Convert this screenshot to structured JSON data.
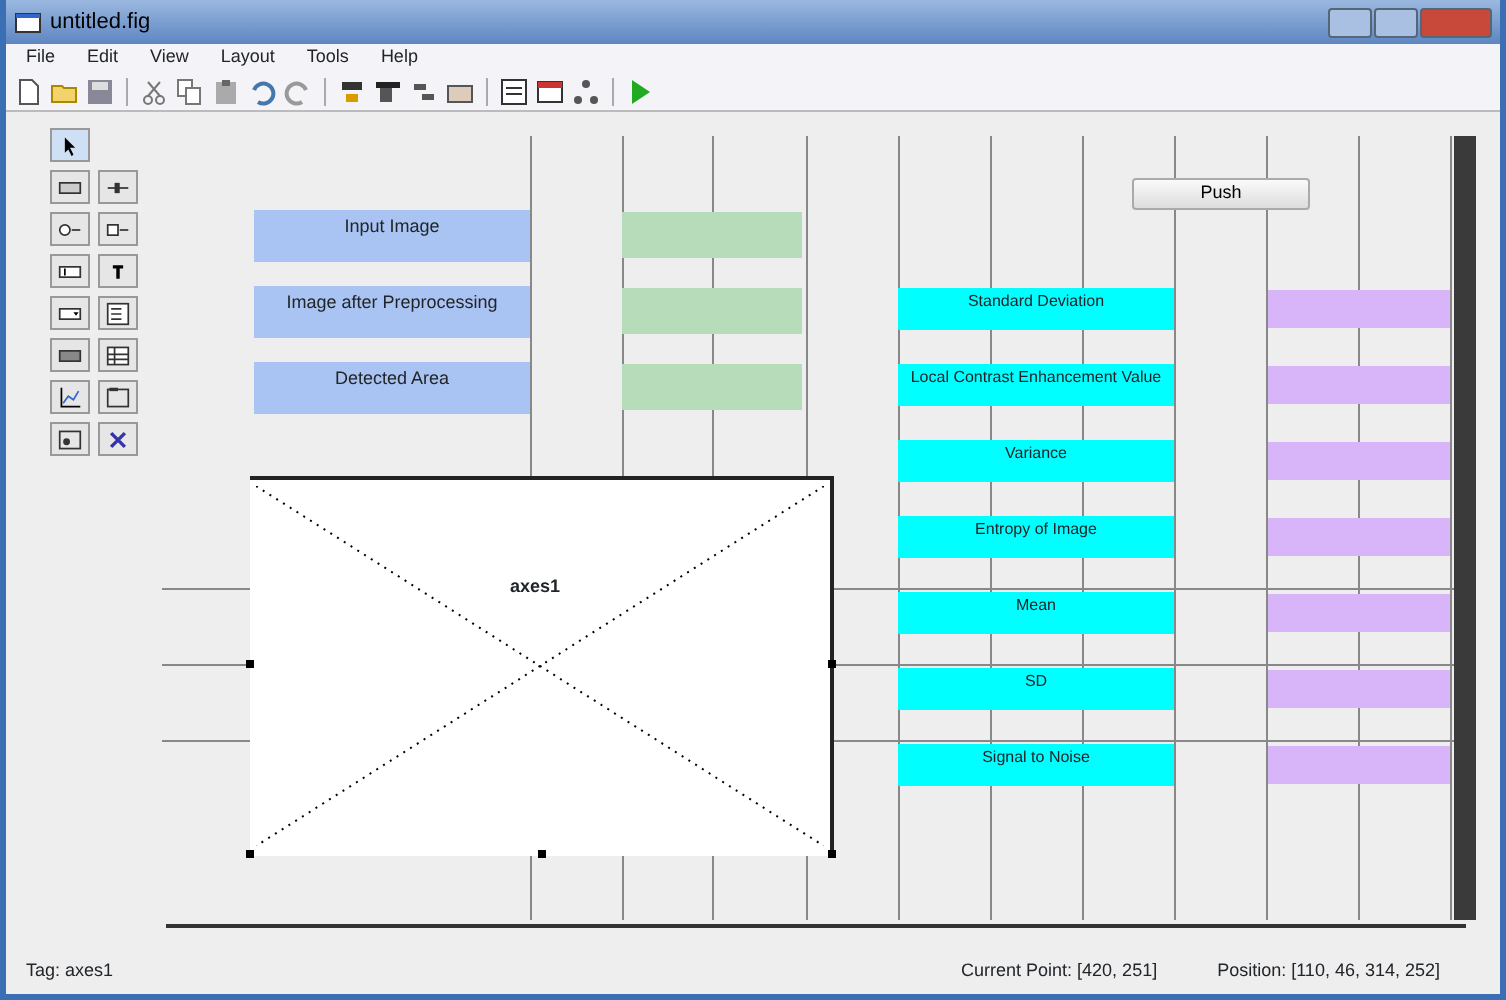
{
  "window": {
    "title": "untitled.fig"
  },
  "menu": [
    "File",
    "Edit",
    "View",
    "Layout",
    "Tools",
    "Help"
  ],
  "toolbar": [
    {
      "kind": "new"
    },
    {
      "kind": "open"
    },
    {
      "kind": "save"
    },
    {
      "kind": "sep"
    },
    {
      "kind": "cut"
    },
    {
      "kind": "copy"
    },
    {
      "kind": "paste"
    },
    {
      "kind": "undo"
    },
    {
      "kind": "redo"
    },
    {
      "kind": "sep"
    },
    {
      "kind": "align"
    },
    {
      "kind": "menu"
    },
    {
      "kind": "tab"
    },
    {
      "kind": "editor"
    },
    {
      "kind": "sep"
    },
    {
      "kind": "inspector"
    },
    {
      "kind": "browser"
    },
    {
      "kind": "tree"
    },
    {
      "kind": "sep"
    },
    {
      "kind": "run"
    }
  ],
  "palette": [
    {
      "kind": "select",
      "selected": true
    },
    {
      "kind": "push",
      "selected": false
    },
    {
      "kind": "slider",
      "selected": false
    },
    {
      "kind": "radio",
      "selected": false
    },
    {
      "kind": "check",
      "selected": false
    },
    {
      "kind": "edit",
      "selected": false
    },
    {
      "kind": "text",
      "selected": false
    },
    {
      "kind": "popup",
      "selected": false
    },
    {
      "kind": "list",
      "selected": false
    },
    {
      "kind": "toggle",
      "selected": false
    },
    {
      "kind": "table",
      "selected": false
    },
    {
      "kind": "axes",
      "selected": false
    },
    {
      "kind": "panel",
      "selected": false
    },
    {
      "kind": "group",
      "selected": false
    },
    {
      "kind": "activex",
      "selected": false
    }
  ],
  "canvas": {
    "button": {
      "label": "Push"
    },
    "left_labels": [
      "Input Image",
      "Image after Preprocessing",
      "Detected Area"
    ],
    "left_fields": [
      {
        "kind": "edit"
      },
      {
        "kind": "edit"
      },
      {
        "kind": "edit"
      }
    ],
    "right_labels": [
      "Standard Deviation",
      "Local Contrast Enhancement Value",
      "Variance",
      "Entropy of Image",
      "Mean",
      "SD",
      "Signal to Noise"
    ],
    "right_fields": [
      {
        "kind": "edit"
      },
      {
        "kind": "edit"
      },
      {
        "kind": "edit"
      },
      {
        "kind": "edit"
      },
      {
        "kind": "edit"
      },
      {
        "kind": "edit"
      },
      {
        "kind": "edit"
      }
    ],
    "axes": {
      "label": "axes1",
      "selected": true
    }
  },
  "status_bar": {
    "tag": "Tag: axes1",
    "current_point": "Current Point:  [420, 251]",
    "position": "Position: [110, 46, 314, 252]"
  }
}
